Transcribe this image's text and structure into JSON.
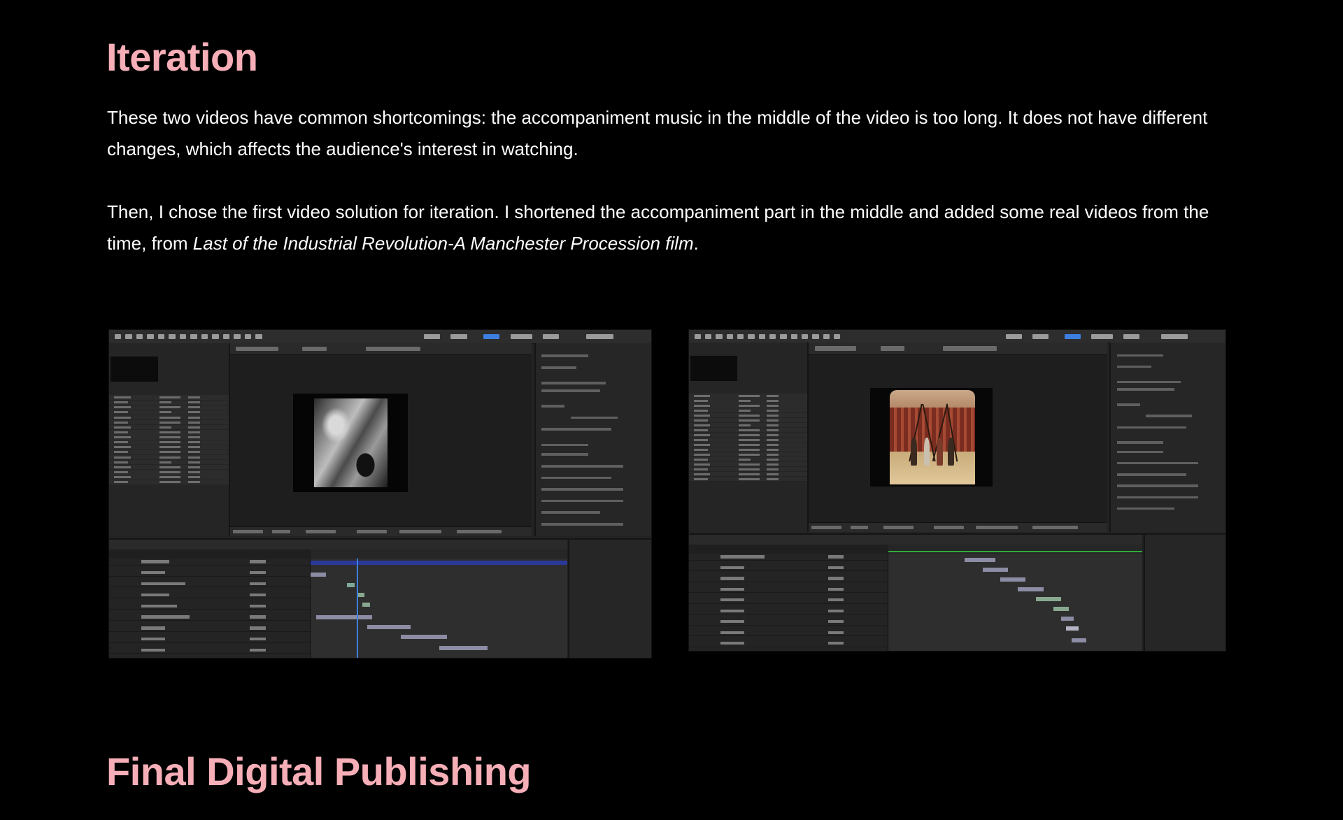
{
  "section_iteration": {
    "heading": "Iteration",
    "paragraph1": "These two videos have common shortcomings: the accompaniment music in the middle of the video is too long. It does not have different changes, which affects the audience's interest in watching.",
    "paragraph2_lead": "Then, I chose the first video solution for iteration. I shortened the accompaniment part in the middle and added some real videos from the time, from ",
    "paragraph2_title": "Last of the Industrial Revolution-A Manchester Procession film",
    "paragraph2_end": "."
  },
  "screenshots": [
    {
      "kind": "after-effects-screenshot",
      "frame": "black-and-white machinery footage"
    },
    {
      "kind": "after-effects-screenshot",
      "frame": "color footage with swings in front of brick buildings"
    }
  ],
  "section_final": {
    "heading": "Final Digital Publishing"
  },
  "colors": {
    "background": "#000000",
    "heading": "#f6aeb7",
    "body_text": "#ffffff"
  }
}
